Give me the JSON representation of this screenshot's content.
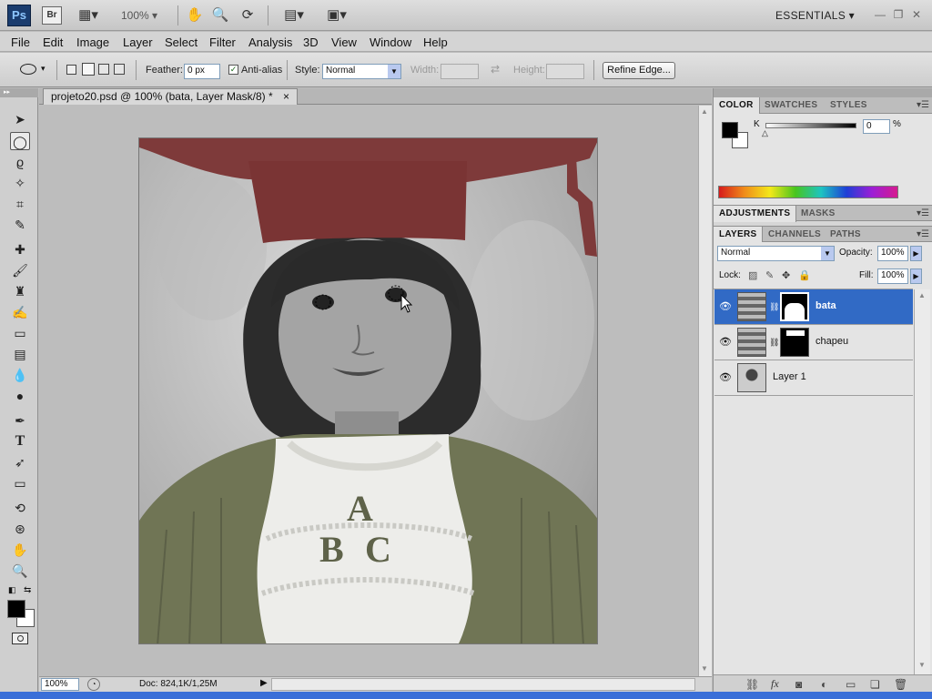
{
  "app": {
    "logo": "Ps",
    "bridge": "Br",
    "zoom": "100%",
    "workspace": "ESSENTIALS"
  },
  "menu": [
    "File",
    "Edit",
    "Image",
    "Layer",
    "Select",
    "Filter",
    "Analysis",
    "3D",
    "View",
    "Window",
    "Help"
  ],
  "options": {
    "feather_label": "Feather:",
    "feather_value": "0 px",
    "antialias_label": "Anti-alias",
    "style_label": "Style:",
    "style_value": "Normal",
    "width_label": "Width:",
    "height_label": "Height:",
    "refine_edge": "Refine Edge..."
  },
  "document": {
    "tab_title": "projeto20.psd @ 100% (bata, Layer Mask/8) *",
    "close": "×"
  },
  "status": {
    "zoom": "100%",
    "doc": "Doc: 824,1K/1,25M"
  },
  "photo": {
    "letters": [
      "A",
      "B",
      "C"
    ]
  },
  "color_panel": {
    "tabs": [
      "COLOR",
      "SWATCHES",
      "STYLES"
    ],
    "channel": "K",
    "value": "0",
    "unit": "%"
  },
  "adjust_panel": {
    "tabs": [
      "ADJUSTMENTS",
      "MASKS"
    ]
  },
  "layers_panel": {
    "tabs": [
      "LAYERS",
      "CHANNELS",
      "PATHS"
    ],
    "blend": "Normal",
    "opacity_label": "Opacity:",
    "opacity": "100%",
    "lock_label": "Lock:",
    "fill_label": "Fill:",
    "fill": "100%",
    "layers": [
      {
        "name": "bata",
        "active": true
      },
      {
        "name": "chapeu",
        "active": false
      },
      {
        "name": "Layer 1",
        "active": false
      }
    ]
  },
  "colors": {
    "hat": "#7e3a3a",
    "gown": "#707555",
    "selection": "#316ac5"
  }
}
